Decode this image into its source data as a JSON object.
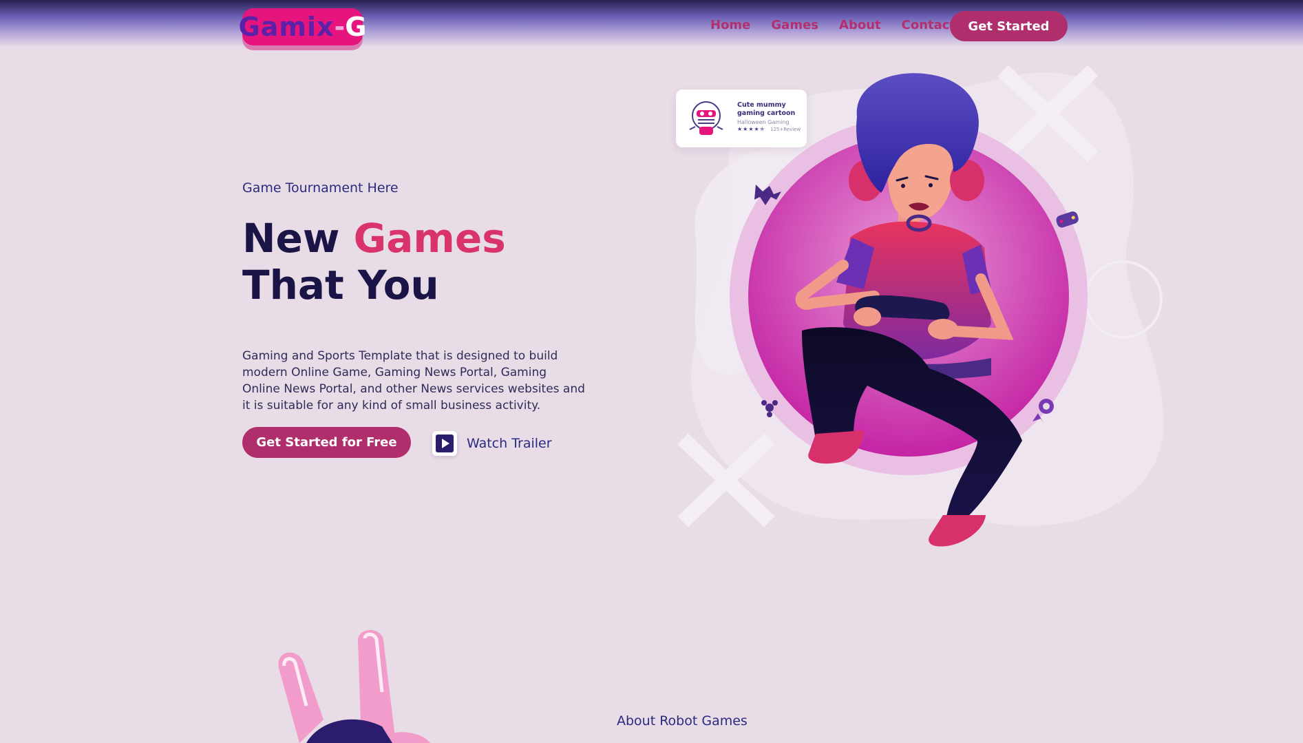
{
  "header": {
    "logo": {
      "word": "Gamix",
      "dash": "-",
      "letter": "G"
    },
    "nav": [
      "Home",
      "Games",
      "About",
      "Contact"
    ],
    "cta": "Get Started"
  },
  "hero": {
    "eyebrow": "Game Tournament Here",
    "title_line1_plain": "New",
    "title_line1_accent": "Games",
    "title_line2": "That You",
    "description": "Gaming and Sports Template that is designed to build modern Online Game, Gaming News Portal, Gaming Online News Portal, and other News services websites and it is suitable for any kind of small business activity.",
    "primary_button": "Get Started for Free",
    "trailer_label": "Watch Trailer"
  },
  "product_card": {
    "title": "Cute mummy gaming cartoon",
    "subtitle": "Halloween Gaming",
    "stars": "★★★★✯",
    "reviews": "125+Review",
    "rating": 4.5
  },
  "about": {
    "label": "About Robot Games"
  },
  "icons": {
    "play": "play-icon",
    "bat": "bat-icon",
    "gamepad": "gamepad-icon",
    "dpad": "dpad-icon",
    "medal": "medal-icon"
  },
  "colors": {
    "background": "#e8dce6",
    "accent": "#b02e6c",
    "logo_bg": "#e5157d",
    "title": "#1b1446",
    "highlight": "#d8336b",
    "link": "#2a2a80"
  }
}
